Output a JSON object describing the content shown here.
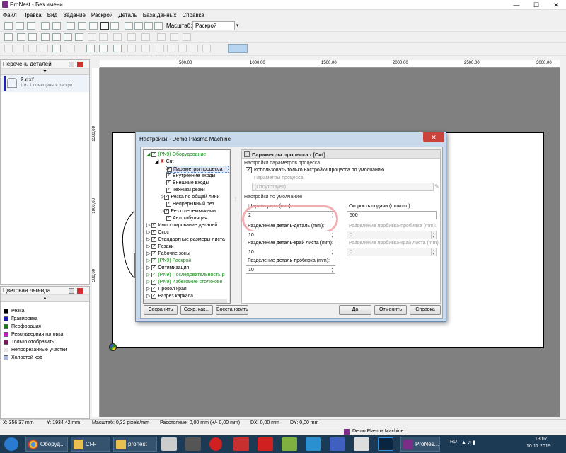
{
  "window": {
    "title": "ProNest - Без имени",
    "min": "—",
    "max": "☐",
    "close": "✕"
  },
  "menu": [
    "Файл",
    "Правка",
    "Вид",
    "Задание",
    "Раскрой",
    "Деталь",
    "База данных",
    "Справка"
  ],
  "toolbar": {
    "scale_label": "Масштаб:",
    "scale_value": "Раскрой"
  },
  "parts_panel": {
    "title": "Перечень деталей",
    "file": "2.dxf",
    "file_note": "1 из 1 помещены в раскро"
  },
  "legend_panel": {
    "title": "Цветовая легенда",
    "items": [
      {
        "label": "Резка",
        "color": "#000000"
      },
      {
        "label": "Гравировка",
        "color": "#1a1ab0"
      },
      {
        "label": "Перфорация",
        "color": "#1a7a1a"
      },
      {
        "label": "Револьверная головка",
        "color": "#c020c0"
      },
      {
        "label": "Только отобразить",
        "color": "#7a1a5a"
      },
      {
        "label": "Непрорезанные участки",
        "color": "#e8e8e8"
      },
      {
        "label": "Холостой ход",
        "color": "#a8b8e0"
      }
    ]
  },
  "ruler": {
    "h": [
      "500,00",
      "1000,00",
      "1500,00",
      "2000,00",
      "2500,00",
      "3000,00"
    ],
    "v": [
      "1500,00",
      "1000,00",
      "500,00"
    ]
  },
  "dialog": {
    "title": "Настройки - Demo Plasma Machine",
    "close": "✕",
    "tree": [
      {
        "label": "(PN9) Оборудование",
        "green": true
      },
      {
        "label": "Cut"
      },
      {
        "label": "Параметры процесса",
        "sel": true
      },
      {
        "label": "Внутренние входы"
      },
      {
        "label": "Внешние входы"
      },
      {
        "label": "Техники резки"
      },
      {
        "label": "Резка по общей лини"
      },
      {
        "label": "Непрерывный рез"
      },
      {
        "label": "Рез с перемычками"
      },
      {
        "label": "Автотабуляция"
      },
      {
        "label": "Импортирование деталей"
      },
      {
        "label": "Скос"
      },
      {
        "label": "Стандартные размеры листа"
      },
      {
        "label": "Резаки"
      },
      {
        "label": "Рабочие зоны"
      },
      {
        "label": "(PN9) Раскрой",
        "green": true
      },
      {
        "label": "Оптимизация"
      },
      {
        "label": "(PN9) Последовательность р",
        "green": true
      },
      {
        "label": "(PN9) Избежание столкнове",
        "green": true
      },
      {
        "label": "Прокол края"
      },
      {
        "label": "Разрез каркаса"
      }
    ],
    "panel_title": "Параметры процесса - [Cut]",
    "group1": "Настройки параметров процесса",
    "use_default_label": "Использовать только настройки процесса по умолчанию",
    "process_params_label": "Параметры процесса:",
    "process_params_value": "(Отсутствует)",
    "group2": "Настройки по умолчанию",
    "kerf_label": "Ширина реза (mm):",
    "kerf_value": "2",
    "feed_label": "Скорость подачи (mm/min):",
    "feed_value": "500",
    "part_part_label": "Разделение деталь-деталь (mm):",
    "part_part_value": "10",
    "pierce_pierce_label": "Разделение пробивка-пробивка (mm):",
    "pierce_pierce_value": "0",
    "part_edge_label": "Разделение деталь-край листа (mm):",
    "part_edge_value": "10",
    "pierce_edge_label": "Разделение пробивка-край листа (mm):",
    "pierce_edge_value": "0",
    "part_pierce_label": "Разделение деталь-пробивка (mm):",
    "part_pierce_value": "10",
    "buttons": {
      "save": "Сохранить",
      "save_as": "Сохр. как...",
      "restore": "Восстановить",
      "ok": "Да",
      "cancel": "Отменить",
      "help": "Справка"
    }
  },
  "status": {
    "x": "X: 356,37 mm",
    "y": "Y: 1934,42 mm",
    "scale": "Масштаб: 0,32 pixels/mm",
    "dist": "Расстояние: 0,00 mm (+/- 0,00 mm)",
    "dx": "DX: 0,00 mm",
    "dy": "DY: 0,00 mm"
  },
  "machine_bar": "Demo Plasma Machine",
  "taskbar": {
    "chrome": "Оборуд...",
    "cff": "CFF",
    "pronest_folder": "pronest",
    "pronest_app": "ProNes...",
    "lang": "RU",
    "time": "13:07",
    "date": "10.11.2019"
  }
}
